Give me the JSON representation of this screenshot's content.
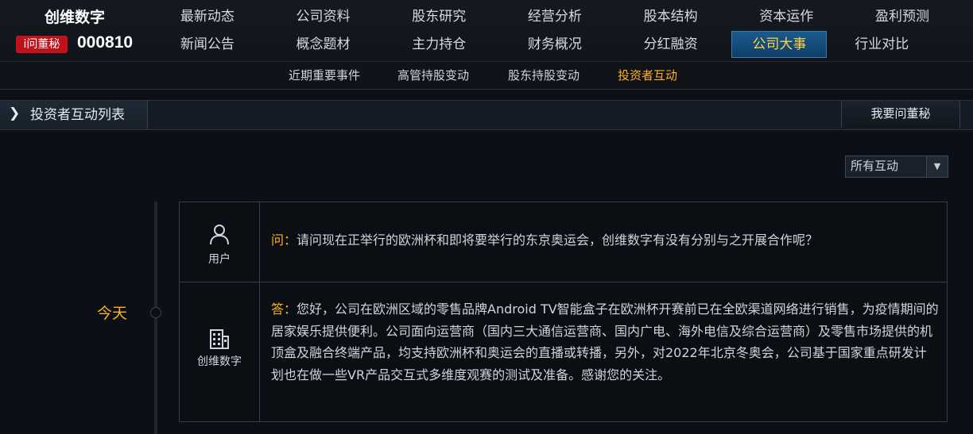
{
  "header": {
    "company_name": "创维数字",
    "ask_badge": "i问董秘",
    "stock_code": "000810"
  },
  "nav": {
    "row1": [
      "最新动态",
      "公司资料",
      "股东研究",
      "经营分析",
      "股本结构",
      "资本运作",
      "盈利预测"
    ],
    "row2": [
      "新闻公告",
      "概念题材",
      "主力持仓",
      "财务概况",
      "分红融资",
      "公司大事",
      "行业对比"
    ],
    "active_item": "公司大事"
  },
  "subnav": {
    "items": [
      "近期重要事件",
      "高管持股变动",
      "股东持股变动",
      "投资者互动"
    ],
    "active_item": "投资者互动"
  },
  "section": {
    "title": "投资者互动列表",
    "ask_button": "我要问董秘"
  },
  "filter": {
    "selected": "所有互动"
  },
  "timeline": {
    "date_label": "今天"
  },
  "qa": {
    "question": {
      "user_label": "用户",
      "prefix": "问：",
      "text": "请问现在正举行的欧洲杯和即将要举行的东京奥运会，创维数字有没有分别与之开展合作呢？"
    },
    "answer": {
      "user_label": "创维数字",
      "prefix": "答：",
      "text": "您好，公司在欧洲区域的零售品牌Android TV智能盒子在欧洲杯开赛前已在全欧渠道网络进行销售，为疫情期间的居家娱乐提供便利。公司面向运营商（国内三大通信运营商、国内广电、海外电信及综合运营商）及零售市场提供的机顶盒及融合终端产品，均支持欧洲杯和奥运会的直播或转播，另外，对2022年北京冬奥会，公司基于国家重点研发计划也在做一些VR产品交互式多维度观赛的测试及准备。感谢您的关注。"
    }
  },
  "icons": {
    "chevron": "chevron-right-icon",
    "dropdown": "triangle-down-icon",
    "user": "user-icon",
    "company": "building-icon"
  },
  "colors": {
    "accent": "#ffb21e",
    "badge_red": "#c0121a",
    "active_tab": "#1c5a8c"
  }
}
